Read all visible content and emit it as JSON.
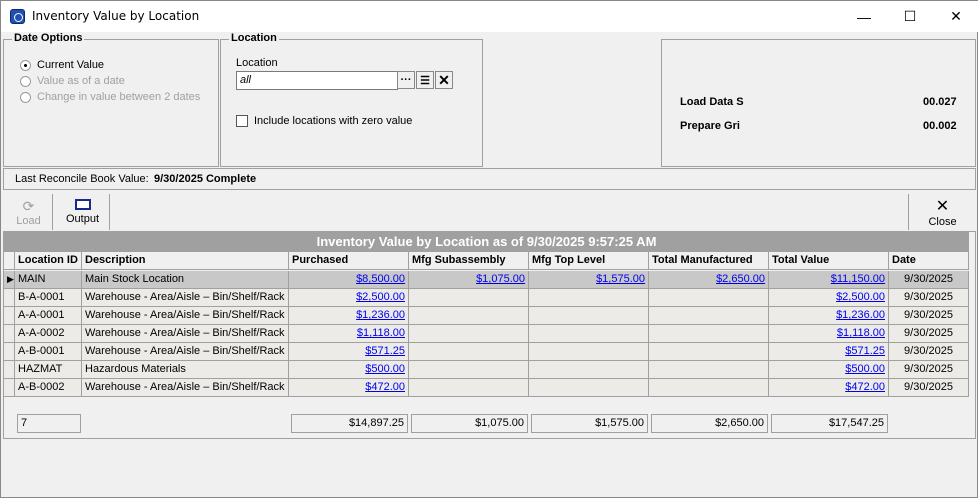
{
  "window": {
    "title": "Inventory Value by Location",
    "minimize": "—",
    "maximize": "☐",
    "close": "✕"
  },
  "date_options": {
    "legend": "Date Options",
    "options": [
      {
        "label": "Current Value",
        "selected": true,
        "enabled": true
      },
      {
        "label": "Value as of a date",
        "selected": false,
        "enabled": false
      },
      {
        "label": "Change in value between 2 dates",
        "selected": false,
        "enabled": false
      }
    ]
  },
  "location": {
    "legend": "Location",
    "field_label": "Location",
    "value": "all",
    "browse": "···",
    "list": "☰",
    "clear": "✕",
    "include_zero_label": "Include locations with zero value",
    "include_zero_checked": false
  },
  "timing": {
    "rows": [
      {
        "label": "Load Data S",
        "value": "00.027"
      },
      {
        "label": "Prepare Gri",
        "value": "00.002"
      }
    ]
  },
  "reconcile": {
    "label": "Last Reconcile Book Value:",
    "value": "9/30/2025 Complete"
  },
  "toolbar": {
    "load": "Load",
    "output": "Output",
    "close": "Close"
  },
  "grid": {
    "title": "Inventory Value by Location as of 9/30/2025 9:57:25 AM",
    "columns": [
      "Location ID",
      "Description",
      "Purchased",
      "Mfg Subassembly",
      "Mfg Top Level",
      "Total Manufactured",
      "Total Value",
      "Date"
    ],
    "rows": [
      [
        "MAIN",
        "Main Stock Location",
        "$8,500.00",
        "$1,075.00",
        "$1,575.00",
        "$2,650.00",
        "$11,150.00",
        "9/30/2025"
      ],
      [
        "B-A-0001",
        "Warehouse - Area/Aisle – Bin/Shelf/Rack",
        "$2,500.00",
        "",
        "",
        "",
        "$2,500.00",
        "9/30/2025"
      ],
      [
        "A-A-0001",
        "Warehouse - Area/Aisle – Bin/Shelf/Rack",
        "$1,236.00",
        "",
        "",
        "",
        "$1,236.00",
        "9/30/2025"
      ],
      [
        "A-A-0002",
        "Warehouse - Area/Aisle – Bin/Shelf/Rack",
        "$1,118.00",
        "",
        "",
        "",
        "$1,118.00",
        "9/30/2025"
      ],
      [
        "A-B-0001",
        "Warehouse - Area/Aisle – Bin/Shelf/Rack",
        "$571.25",
        "",
        "",
        "",
        "$571.25",
        "9/30/2025"
      ],
      [
        "HAZMAT",
        "Hazardous Materials",
        "$500.00",
        "",
        "",
        "",
        "$500.00",
        "9/30/2025"
      ],
      [
        "A-B-0002",
        "Warehouse - Area/Aisle – Bin/Shelf/Rack",
        "$472.00",
        "",
        "",
        "",
        "$472.00",
        "9/30/2025"
      ]
    ],
    "totals": {
      "count": "7",
      "purchased": "$14,897.25",
      "mfg_sub": "$1,075.00",
      "mfg_top": "$1,575.00",
      "total_mfg": "$2,650.00",
      "total_value": "$17,547.25"
    }
  }
}
